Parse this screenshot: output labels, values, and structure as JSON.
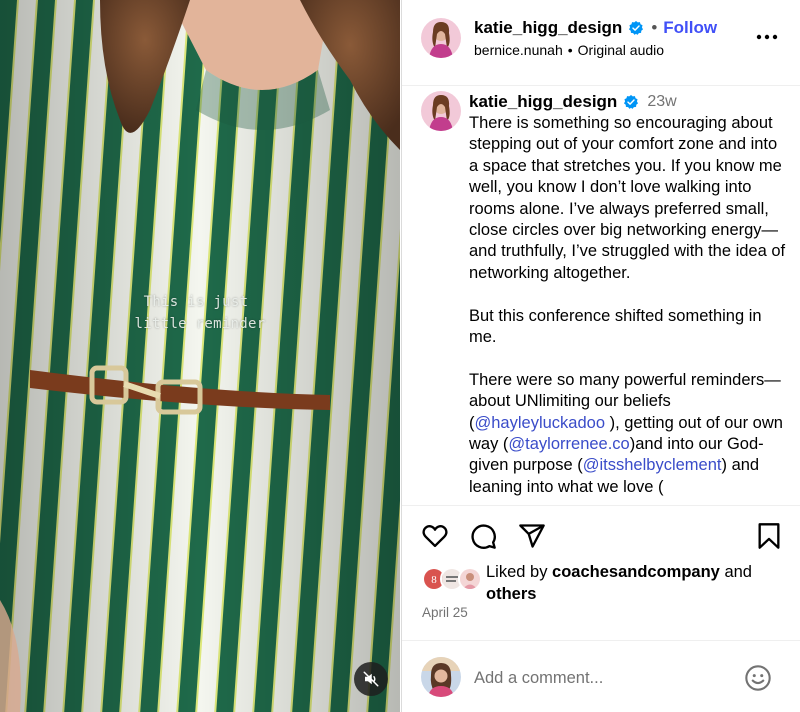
{
  "media": {
    "overlay_line1": "This is just",
    "overlay_line2": "little reminder",
    "mute_icon": "speaker-muted-icon"
  },
  "header": {
    "username": "katie_higg_design",
    "separator": "•",
    "follow_label": "Follow",
    "audio_user": "bernice.nunah",
    "audio_separator": "•",
    "audio_label": "Original audio",
    "more_icon": "more-options-icon"
  },
  "caption": {
    "username": "katie_higg_design",
    "time": "23w",
    "p1": "There is something so encouraging about stepping out of your comfort zone and into a space that stretches you. If you know me well, you know I don’t love walking into rooms alone. I’ve always preferred small, close circles over big networking energy—and truthfully, I’ve struggled with the idea of networking altogether.",
    "p2": "But this conference shifted something in me.",
    "p3_a": "There were so many powerful reminders—about UNlimiting our beliefs (",
    "p3_m1": "@hayleyluckadoo",
    "p3_b": " ), getting out of our own way (",
    "p3_m2": "@taylorrenee.co",
    "p3_c": ")and into our God-given purpose (",
    "p3_m3": "@itsshelbyclement",
    "p3_d": ") and leaning into what we love ("
  },
  "actions": {
    "like_icon": "heart-icon",
    "comment_icon": "comment-icon",
    "share_icon": "share-icon",
    "save_icon": "bookmark-icon"
  },
  "likes": {
    "prefix": "Liked by ",
    "user": "coachesandcompany",
    "middle": " and",
    "others": "others"
  },
  "date": "April 25",
  "comment": {
    "placeholder": "Add a comment...",
    "emoji_icon": "emoji-icon"
  },
  "colors": {
    "link_blue": "#4150f7",
    "verified_blue": "#0095f6",
    "muted_gray": "#737373"
  }
}
